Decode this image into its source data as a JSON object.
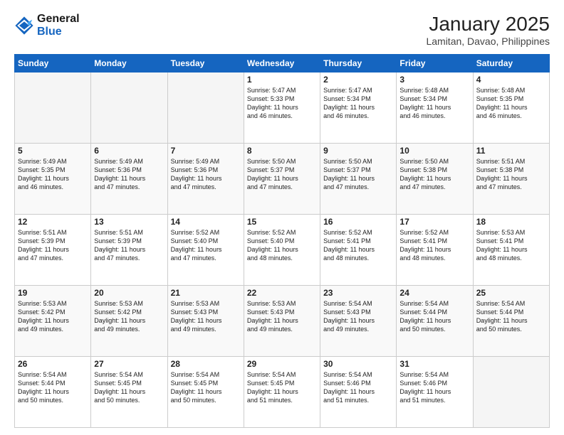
{
  "logo": {
    "line1": "General",
    "line2": "Blue"
  },
  "header": {
    "month": "January 2025",
    "location": "Lamitan, Davao, Philippines"
  },
  "weekdays": [
    "Sunday",
    "Monday",
    "Tuesday",
    "Wednesday",
    "Thursday",
    "Friday",
    "Saturday"
  ],
  "weeks": [
    [
      {
        "day": "",
        "text": ""
      },
      {
        "day": "",
        "text": ""
      },
      {
        "day": "",
        "text": ""
      },
      {
        "day": "1",
        "text": "Sunrise: 5:47 AM\nSunset: 5:33 PM\nDaylight: 11 hours\nand 46 minutes."
      },
      {
        "day": "2",
        "text": "Sunrise: 5:47 AM\nSunset: 5:34 PM\nDaylight: 11 hours\nand 46 minutes."
      },
      {
        "day": "3",
        "text": "Sunrise: 5:48 AM\nSunset: 5:34 PM\nDaylight: 11 hours\nand 46 minutes."
      },
      {
        "day": "4",
        "text": "Sunrise: 5:48 AM\nSunset: 5:35 PM\nDaylight: 11 hours\nand 46 minutes."
      }
    ],
    [
      {
        "day": "5",
        "text": "Sunrise: 5:49 AM\nSunset: 5:35 PM\nDaylight: 11 hours\nand 46 minutes."
      },
      {
        "day": "6",
        "text": "Sunrise: 5:49 AM\nSunset: 5:36 PM\nDaylight: 11 hours\nand 47 minutes."
      },
      {
        "day": "7",
        "text": "Sunrise: 5:49 AM\nSunset: 5:36 PM\nDaylight: 11 hours\nand 47 minutes."
      },
      {
        "day": "8",
        "text": "Sunrise: 5:50 AM\nSunset: 5:37 PM\nDaylight: 11 hours\nand 47 minutes."
      },
      {
        "day": "9",
        "text": "Sunrise: 5:50 AM\nSunset: 5:37 PM\nDaylight: 11 hours\nand 47 minutes."
      },
      {
        "day": "10",
        "text": "Sunrise: 5:50 AM\nSunset: 5:38 PM\nDaylight: 11 hours\nand 47 minutes."
      },
      {
        "day": "11",
        "text": "Sunrise: 5:51 AM\nSunset: 5:38 PM\nDaylight: 11 hours\nand 47 minutes."
      }
    ],
    [
      {
        "day": "12",
        "text": "Sunrise: 5:51 AM\nSunset: 5:39 PM\nDaylight: 11 hours\nand 47 minutes."
      },
      {
        "day": "13",
        "text": "Sunrise: 5:51 AM\nSunset: 5:39 PM\nDaylight: 11 hours\nand 47 minutes."
      },
      {
        "day": "14",
        "text": "Sunrise: 5:52 AM\nSunset: 5:40 PM\nDaylight: 11 hours\nand 47 minutes."
      },
      {
        "day": "15",
        "text": "Sunrise: 5:52 AM\nSunset: 5:40 PM\nDaylight: 11 hours\nand 48 minutes."
      },
      {
        "day": "16",
        "text": "Sunrise: 5:52 AM\nSunset: 5:41 PM\nDaylight: 11 hours\nand 48 minutes."
      },
      {
        "day": "17",
        "text": "Sunrise: 5:52 AM\nSunset: 5:41 PM\nDaylight: 11 hours\nand 48 minutes."
      },
      {
        "day": "18",
        "text": "Sunrise: 5:53 AM\nSunset: 5:41 PM\nDaylight: 11 hours\nand 48 minutes."
      }
    ],
    [
      {
        "day": "19",
        "text": "Sunrise: 5:53 AM\nSunset: 5:42 PM\nDaylight: 11 hours\nand 49 minutes."
      },
      {
        "day": "20",
        "text": "Sunrise: 5:53 AM\nSunset: 5:42 PM\nDaylight: 11 hours\nand 49 minutes."
      },
      {
        "day": "21",
        "text": "Sunrise: 5:53 AM\nSunset: 5:43 PM\nDaylight: 11 hours\nand 49 minutes."
      },
      {
        "day": "22",
        "text": "Sunrise: 5:53 AM\nSunset: 5:43 PM\nDaylight: 11 hours\nand 49 minutes."
      },
      {
        "day": "23",
        "text": "Sunrise: 5:54 AM\nSunset: 5:43 PM\nDaylight: 11 hours\nand 49 minutes."
      },
      {
        "day": "24",
        "text": "Sunrise: 5:54 AM\nSunset: 5:44 PM\nDaylight: 11 hours\nand 50 minutes."
      },
      {
        "day": "25",
        "text": "Sunrise: 5:54 AM\nSunset: 5:44 PM\nDaylight: 11 hours\nand 50 minutes."
      }
    ],
    [
      {
        "day": "26",
        "text": "Sunrise: 5:54 AM\nSunset: 5:44 PM\nDaylight: 11 hours\nand 50 minutes."
      },
      {
        "day": "27",
        "text": "Sunrise: 5:54 AM\nSunset: 5:45 PM\nDaylight: 11 hours\nand 50 minutes."
      },
      {
        "day": "28",
        "text": "Sunrise: 5:54 AM\nSunset: 5:45 PM\nDaylight: 11 hours\nand 50 minutes."
      },
      {
        "day": "29",
        "text": "Sunrise: 5:54 AM\nSunset: 5:45 PM\nDaylight: 11 hours\nand 51 minutes."
      },
      {
        "day": "30",
        "text": "Sunrise: 5:54 AM\nSunset: 5:46 PM\nDaylight: 11 hours\nand 51 minutes."
      },
      {
        "day": "31",
        "text": "Sunrise: 5:54 AM\nSunset: 5:46 PM\nDaylight: 11 hours\nand 51 minutes."
      },
      {
        "day": "",
        "text": ""
      }
    ]
  ]
}
